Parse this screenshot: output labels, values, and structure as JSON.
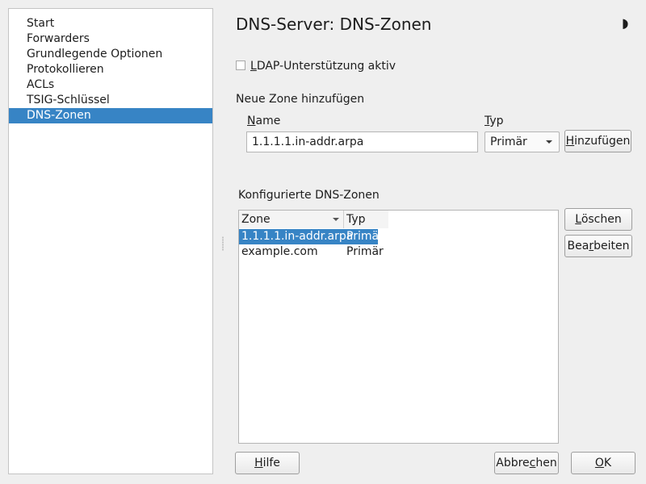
{
  "sidebar": {
    "items": [
      {
        "label": "Start"
      },
      {
        "label": "Forwarders"
      },
      {
        "label": "Grundlegende Optionen"
      },
      {
        "label": "Protokollieren"
      },
      {
        "label": "ACLs"
      },
      {
        "label": "TSIG-Schlüssel"
      },
      {
        "label": "DNS-Zonen",
        "selected": true
      }
    ]
  },
  "header": {
    "title": "DNS-Server: DNS-Zonen",
    "moon_icon": "◗"
  },
  "ldap": {
    "checked": false,
    "label_mnemonic": "L",
    "label_rest": "DAP-Unterstützung aktiv"
  },
  "add_zone": {
    "heading": "Neue Zone hinzufügen",
    "name_label_mnemonic": "N",
    "name_label_rest": "ame",
    "name_value": "1.1.1.1.in-addr.arpa",
    "type_label_mnemonic": "T",
    "type_label_rest": "yp",
    "type_value": "Primär",
    "add_button_pre": "",
    "add_button_mnemonic": "H",
    "add_button_post": "inzufügen"
  },
  "zones": {
    "heading": "Konfigurierte DNS-Zonen",
    "columns": {
      "zone": "Zone",
      "typ": "Typ"
    },
    "rows": [
      {
        "zone": "1.1.1.1.in-addr.arpa",
        "typ": "Primär",
        "selected": true
      },
      {
        "zone": "example.com",
        "typ": "Primär",
        "selected": false
      }
    ],
    "delete_button_mnemonic": "L",
    "delete_button_post": "öschen",
    "edit_button_pre": "Bea",
    "edit_button_mnemonic": "r",
    "edit_button_post": "beiten"
  },
  "footer": {
    "help_pre": "",
    "help_mnemonic": "H",
    "help_post": "ilfe",
    "cancel_pre": "Abbre",
    "cancel_mnemonic": "c",
    "cancel_post": "hen",
    "ok_pre": "",
    "ok_mnemonic": "O",
    "ok_post": "K"
  },
  "colors": {
    "selection": "#3784c5",
    "window_bg": "#efefef"
  }
}
